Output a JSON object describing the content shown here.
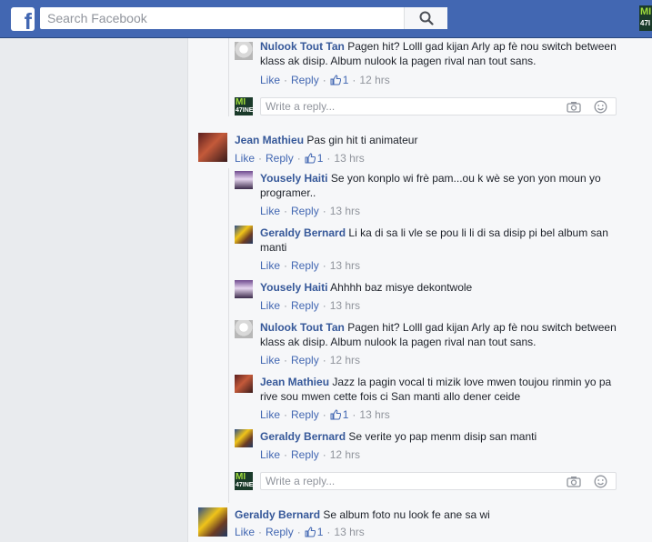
{
  "header": {
    "logo_letter": "f",
    "search_placeholder": "Search Facebook",
    "corner_logo_top": "MI",
    "corner_logo_bottom": "47I"
  },
  "colors": {
    "topbar": "#4267b2",
    "link": "#365899",
    "action": "#4267b2",
    "muted": "#90949c",
    "background": "#e9ebee"
  },
  "reply_placeholder": "Write a reply...",
  "mizik_avatar": {
    "top": "MI",
    "bottom": "47INE"
  },
  "actions": {
    "like": "Like",
    "reply": "Reply",
    "dot": "·"
  },
  "comments": [
    {
      "author": "Nulook Tout Tan",
      "text": "Pagen hit? Lolll gad kijan Arly ap fè nou switch between klass ak disip. Album nulook la pagen rival nan tout sans.",
      "likes": "1",
      "time": "12 hrs"
    },
    {
      "author": "Jean Mathieu",
      "text": "Pas gin hit ti animateur",
      "likes": "1",
      "time": "13 hrs"
    },
    {
      "author": "Yousely Haiti",
      "text": "Se yon konplo wi frè pam...ou k wè se yon yon moun yo programer..",
      "likes": "",
      "time": "13 hrs"
    },
    {
      "author": "Geraldy Bernard",
      "text": "Li ka di sa li vle se pou li li di sa disip pi bel album san manti",
      "likes": "",
      "time": "13 hrs"
    },
    {
      "author": "Yousely Haiti",
      "text": "Ahhhh baz misye dekontwole",
      "likes": "",
      "time": "13 hrs"
    },
    {
      "author": "Nulook Tout Tan",
      "text": "Pagen hit? Lolll gad kijan Arly ap fè nou switch between klass ak disip. Album nulook la pagen rival nan tout sans.",
      "likes": "",
      "time": "12 hrs"
    },
    {
      "author": "Jean Mathieu",
      "text": "Jazz la pagin vocal ti mizik love mwen toujou rinmin yo pa rive sou mwen cette fois ci San manti allo dener ceide",
      "likes": "1",
      "time": "13 hrs"
    },
    {
      "author": "Geraldy Bernard",
      "text": "Se verite yo pap menm disip san manti",
      "likes": "",
      "time": "12 hrs"
    },
    {
      "author": "Geraldy Bernard",
      "text": "Se album foto nu look fe ane sa wi",
      "likes": "1",
      "time": "13 hrs"
    }
  ]
}
